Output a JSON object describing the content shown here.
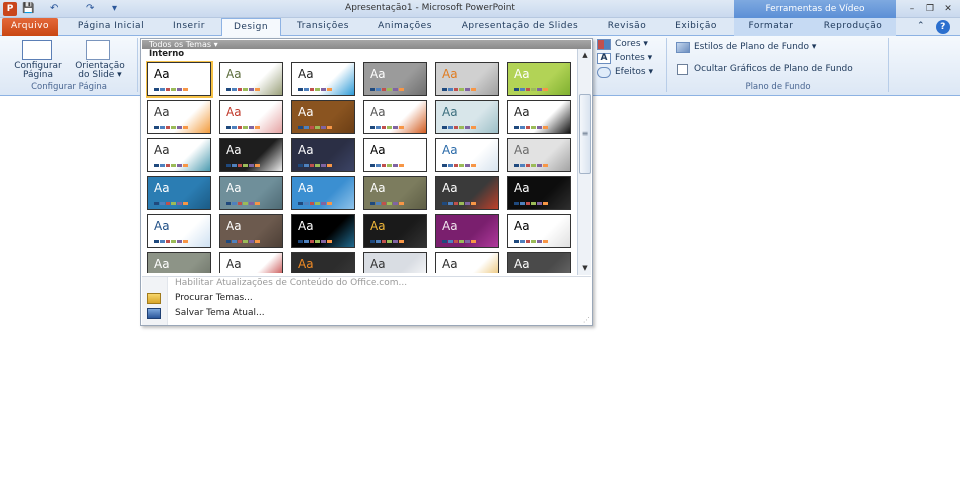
{
  "titlebar": {
    "app_icon": "P",
    "qat_save": "💾",
    "qat_undo": "↶",
    "qat_redo": "↷",
    "qat_more": "▾",
    "title": "Apresentação1 - Microsoft PowerPoint",
    "context_title": "Ferramentas de Vídeo",
    "minimize": "–",
    "restore": "❐",
    "close": "✕"
  },
  "tabs": {
    "file": "Arquivo",
    "home": "Página Inicial",
    "insert": "Inserir",
    "design": "Design",
    "transitions": "Transições",
    "animations": "Animações",
    "slideshow": "Apresentação de Slides",
    "review": "Revisão",
    "view": "Exibição",
    "format": "Formatar",
    "playback": "Reprodução",
    "collapse_icon": "⌃",
    "help_icon": "?"
  },
  "ribbon": {
    "page_setup_label1": "Configurar",
    "page_setup_label2": "Página",
    "orientation_label1": "Orientação",
    "orientation_label2": "do Slide ▾",
    "group_page_setup": "Configurar Página",
    "colors": "Cores ▾",
    "fonts": "Fontes ▾",
    "effects": "Efeitos ▾",
    "bg_styles": "Estilos de Plano de Fundo ▾",
    "hide_bg": "Ocultar Gráficos de Plano de Fundo",
    "group_background": "Plano de Fundo"
  },
  "gallery": {
    "header": "Todos os Temas ▾",
    "section": "Interno",
    "thumb_text": "Aa",
    "themes": [
      {
        "bg": "#ffffff",
        "fg": "#000000",
        "accent": "#ffffff"
      },
      {
        "bg": "#ffffff",
        "fg": "#5a6b3a",
        "accent": "#9aa07a"
      },
      {
        "bg": "#ffffff",
        "fg": "#1f1f1f",
        "accent": "#2d9ad6"
      },
      {
        "bg": "#9b9b9b",
        "fg": "#ffffff",
        "accent": "#6e6e6e"
      },
      {
        "bg": "#d0d0d0",
        "fg": "#e07b1f",
        "accent": "#9f9f9f"
      },
      {
        "bg": "#b2d356",
        "fg": "#ffffff",
        "accent": "#7fb030"
      },
      {
        "bg": "#ffffff",
        "fg": "#333333",
        "accent": "#f29b3c"
      },
      {
        "bg": "#ffffff",
        "fg": "#c0392b",
        "accent": "#e5a3a3"
      },
      {
        "bg": "#8a5420",
        "fg": "#ffffff",
        "accent": "#6b3e15"
      },
      {
        "bg": "#ffffff",
        "fg": "#555555",
        "accent": "#d15b1f"
      },
      {
        "bg": "#d8e6ea",
        "fg": "#3c6f7e",
        "accent": "#9dbfc7"
      },
      {
        "bg": "#ffffff",
        "fg": "#222222",
        "accent": "#111111"
      },
      {
        "bg": "#ffffff",
        "fg": "#2a2a2a",
        "accent": "#4c9bb0"
      },
      {
        "bg": "#1e1e1e",
        "fg": "#ffffff",
        "accent": "#efefef"
      },
      {
        "bg": "#2b2f45",
        "fg": "#ffffff",
        "accent": "#3c4466"
      },
      {
        "bg": "#ffffff",
        "fg": "#000000",
        "accent": "#ffffff"
      },
      {
        "bg": "#ffffff",
        "fg": "#2a6aa8",
        "accent": "#d7e3ee"
      },
      {
        "bg": "#e2e2e2",
        "fg": "#6a6a6a",
        "accent": "#a3a3a3"
      },
      {
        "bg": "#2b7db3",
        "fg": "#ffffff",
        "accent": "#1b5b85"
      },
      {
        "bg": "#6f8f9a",
        "fg": "#ffffff",
        "accent": "#4f6b75"
      },
      {
        "bg": "#3b8fd1",
        "fg": "#ffffff",
        "accent": "#8fc3ea"
      },
      {
        "bg": "#7c7c5e",
        "fg": "#ffffff",
        "accent": "#5e5e45"
      },
      {
        "bg": "#3a3a3a",
        "fg": "#ffffff",
        "accent": "#c0402a"
      },
      {
        "bg": "#0d0d0d",
        "fg": "#ffffff",
        "accent": "#2e2e2e"
      },
      {
        "bg": "#ffffff",
        "fg": "#1f4f86",
        "accent": "#cfe1f2"
      },
      {
        "bg": "#6c5a4e",
        "fg": "#ffffff",
        "accent": "#4d3f36"
      },
      {
        "bg": "#000000",
        "fg": "#ffffff",
        "accent": "#1f6a8f"
      },
      {
        "bg": "#1a1a1a",
        "fg": "#f3b93a",
        "accent": "#333333"
      },
      {
        "bg": "#7a1f6e",
        "fg": "#f0e6ee",
        "accent": "#b03a9c"
      },
      {
        "bg": "#ffffff",
        "fg": "#000000",
        "accent": "#e0e0e0"
      },
      {
        "bg": "#8d9487",
        "fg": "#ffffff",
        "accent": "#6b7166"
      },
      {
        "bg": "#ffffff",
        "fg": "#2b2b2b",
        "accent": "#b81c1c"
      },
      {
        "bg": "#2c2c2c",
        "fg": "#f08a24",
        "accent": "#3c3c3c"
      },
      {
        "bg": "#d9dde3",
        "fg": "#333333",
        "accent": "#ffffff"
      },
      {
        "bg": "#ffffff",
        "fg": "#2b2b2b",
        "accent": "#e6b450"
      },
      {
        "bg": "#4a4a4a",
        "fg": "#ffffff",
        "accent": "#6e6e6e"
      }
    ],
    "swatch_colors": [
      "#1f497d",
      "#4f81bd",
      "#c0504d",
      "#9bbb59",
      "#8064a2",
      "#f79646"
    ],
    "menu_enable_updates": "Habilitar Atualizações de Conteúdo do Office.com...",
    "menu_browse": "Procurar Temas...",
    "menu_save": "Salvar Tema Atual...",
    "scroll_up": "▲",
    "scroll_down": "▼",
    "scroll_more": "≡",
    "gripper": "⋰"
  },
  "colors": {
    "accent": "#2b579a",
    "file_tab": "#c94612",
    "ribbon_border": "#8db2e3"
  }
}
